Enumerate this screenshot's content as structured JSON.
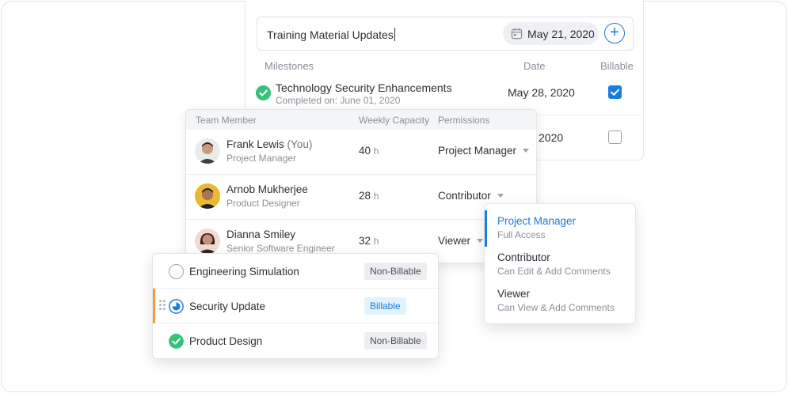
{
  "milestones_panel": {
    "title_input": "Training Material Updates",
    "due_date": "May 21, 2020",
    "headers": {
      "milestones": "Milestones",
      "date": "Date",
      "billable": "Billable"
    },
    "rows": [
      {
        "title": "Technology Security Enhancements",
        "subtitle": "Completed on: June 01, 2020",
        "date": "May 28, 2020",
        "billable": true
      },
      {
        "title": "",
        "subtitle": "",
        "date": "2020",
        "billable": false
      }
    ]
  },
  "team_panel": {
    "headers": {
      "member": "Team Member",
      "capacity": "Weekly Capacity",
      "permissions": "Permissions"
    },
    "members": [
      {
        "name": "Frank Lewis",
        "you_tag": "(You)",
        "role": "Project Manager",
        "capacity": "40",
        "unit": "h",
        "permission": "Project Manager"
      },
      {
        "name": "Arnob Mukherjee",
        "you_tag": "",
        "role": "Product Designer",
        "capacity": "28",
        "unit": "h",
        "permission": "Contributor"
      },
      {
        "name": "Dianna Smiley",
        "you_tag": "",
        "role": "Senior Software Engineer",
        "capacity": "32",
        "unit": "h",
        "permission": "Viewer"
      }
    ]
  },
  "permission_menu": {
    "options": [
      {
        "label": "Project Manager",
        "desc": "Full Access",
        "selected": true
      },
      {
        "label": "Contributor",
        "desc": "Can Edit & Add Comments",
        "selected": false
      },
      {
        "label": "Viewer",
        "desc": "Can View & Add Comments",
        "selected": false
      }
    ]
  },
  "tasks_panel": {
    "tasks": [
      {
        "label": "Engineering Simulation",
        "status": "not-started",
        "badge": "Non-Billable"
      },
      {
        "label": "Security Update",
        "status": "in-progress",
        "badge": "Billable"
      },
      {
        "label": "Product Design",
        "status": "completed",
        "badge": "Non-Billable"
      }
    ]
  },
  "colors": {
    "accent": "#1a7be0",
    "success": "#37c27a",
    "drag_highlight": "#f29b38",
    "muted": "#8a8f98"
  },
  "icons": [
    "calendar-icon",
    "plus-icon",
    "check-circle-icon",
    "dropdown-caret-icon",
    "drag-handle-icon"
  ]
}
